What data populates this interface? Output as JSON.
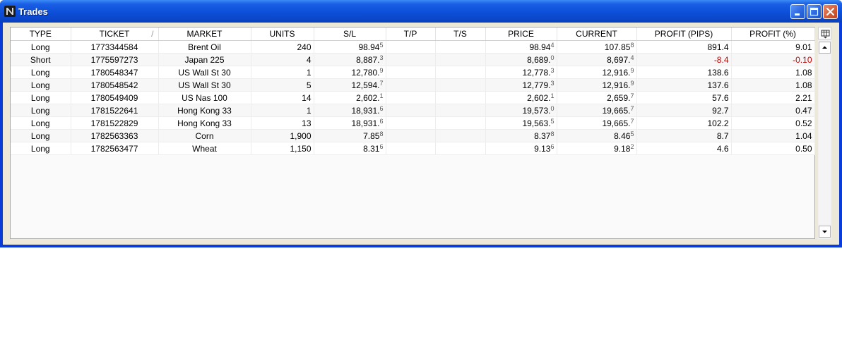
{
  "window": {
    "title": "Trades"
  },
  "table": {
    "columns": [
      {
        "key": "type",
        "label": "TYPE"
      },
      {
        "key": "ticket",
        "label": "TICKET"
      },
      {
        "key": "market",
        "label": "MARKET"
      },
      {
        "key": "units",
        "label": "UNITS"
      },
      {
        "key": "sl",
        "label": "S/L"
      },
      {
        "key": "tp",
        "label": "T/P"
      },
      {
        "key": "ts",
        "label": "T/S"
      },
      {
        "key": "price",
        "label": "PRICE"
      },
      {
        "key": "current",
        "label": "CURRENT"
      },
      {
        "key": "profit_pips",
        "label": "PROFIT (PIPS)"
      },
      {
        "key": "profit_pct",
        "label": "PROFIT (%)"
      }
    ],
    "sort_indicator": "/",
    "rows": [
      {
        "type": "Long",
        "ticket": "1773344584",
        "market": "Brent Oil",
        "units": "240",
        "sl": {
          "main": "98.94",
          "sup": "5"
        },
        "tp": "",
        "ts": "",
        "price": {
          "main": "98.94",
          "sup": "4"
        },
        "current": {
          "main": "107.85",
          "sup": "8"
        },
        "profit_pips": "891.4",
        "profit_pct": "9.01",
        "negative": false
      },
      {
        "type": "Short",
        "ticket": "1775597273",
        "market": "Japan 225",
        "units": "4",
        "sl": {
          "main": "8,887.",
          "sup": "3"
        },
        "tp": "",
        "ts": "",
        "price": {
          "main": "8,689.",
          "sup": "0"
        },
        "current": {
          "main": "8,697.",
          "sup": "4"
        },
        "profit_pips": "-8.4",
        "profit_pct": "-0.10",
        "negative": true
      },
      {
        "type": "Long",
        "ticket": "1780548347",
        "market": "US Wall St 30",
        "units": "1",
        "sl": {
          "main": "12,780.",
          "sup": "9"
        },
        "tp": "",
        "ts": "",
        "price": {
          "main": "12,778.",
          "sup": "3"
        },
        "current": {
          "main": "12,916.",
          "sup": "9"
        },
        "profit_pips": "138.6",
        "profit_pct": "1.08",
        "negative": false
      },
      {
        "type": "Long",
        "ticket": "1780548542",
        "market": "US Wall St 30",
        "units": "5",
        "sl": {
          "main": "12,594.",
          "sup": "7"
        },
        "tp": "",
        "ts": "",
        "price": {
          "main": "12,779.",
          "sup": "3"
        },
        "current": {
          "main": "12,916.",
          "sup": "9"
        },
        "profit_pips": "137.6",
        "profit_pct": "1.08",
        "negative": false
      },
      {
        "type": "Long",
        "ticket": "1780549409",
        "market": "US Nas 100",
        "units": "14",
        "sl": {
          "main": "2,602.",
          "sup": "1"
        },
        "tp": "",
        "ts": "",
        "price": {
          "main": "2,602.",
          "sup": "1"
        },
        "current": {
          "main": "2,659.",
          "sup": "7"
        },
        "profit_pips": "57.6",
        "profit_pct": "2.21",
        "negative": false
      },
      {
        "type": "Long",
        "ticket": "1781522641",
        "market": "Hong Kong 33",
        "units": "1",
        "sl": {
          "main": "18,931.",
          "sup": "6"
        },
        "tp": "",
        "ts": "",
        "price": {
          "main": "19,573.",
          "sup": "0"
        },
        "current": {
          "main": "19,665.",
          "sup": "7"
        },
        "profit_pips": "92.7",
        "profit_pct": "0.47",
        "negative": false
      },
      {
        "type": "Long",
        "ticket": "1781522829",
        "market": "Hong Kong 33",
        "units": "13",
        "sl": {
          "main": "18,931.",
          "sup": "6"
        },
        "tp": "",
        "ts": "",
        "price": {
          "main": "19,563.",
          "sup": "5"
        },
        "current": {
          "main": "19,665.",
          "sup": "7"
        },
        "profit_pips": "102.2",
        "profit_pct": "0.52",
        "negative": false
      },
      {
        "type": "Long",
        "ticket": "1782563363",
        "market": "Corn",
        "units": "1,900",
        "sl": {
          "main": "7.85",
          "sup": "8"
        },
        "tp": "",
        "ts": "",
        "price": {
          "main": "8.37",
          "sup": "8"
        },
        "current": {
          "main": "8.46",
          "sup": "5"
        },
        "profit_pips": "8.7",
        "profit_pct": "1.04",
        "negative": false
      },
      {
        "type": "Long",
        "ticket": "1782563477",
        "market": "Wheat",
        "units": "1,150",
        "sl": {
          "main": "8.31",
          "sup": "6"
        },
        "tp": "",
        "ts": "",
        "price": {
          "main": "9.13",
          "sup": "6"
        },
        "current": {
          "main": "9.18",
          "sup": "2"
        },
        "profit_pips": "4.6",
        "profit_pct": "0.50",
        "negative": false
      }
    ]
  },
  "colors": {
    "titlebar": "#0a46c9",
    "negative_text": "#c80000",
    "frame": "#ece9d8"
  },
  "icons": {
    "app": "app-logo-icon",
    "minimize": "minimize-icon",
    "maximize": "maximize-icon",
    "close": "close-icon",
    "column_config": "column-chooser-icon",
    "scroll_up": "arrow-up-icon",
    "scroll_down": "arrow-down-icon"
  }
}
